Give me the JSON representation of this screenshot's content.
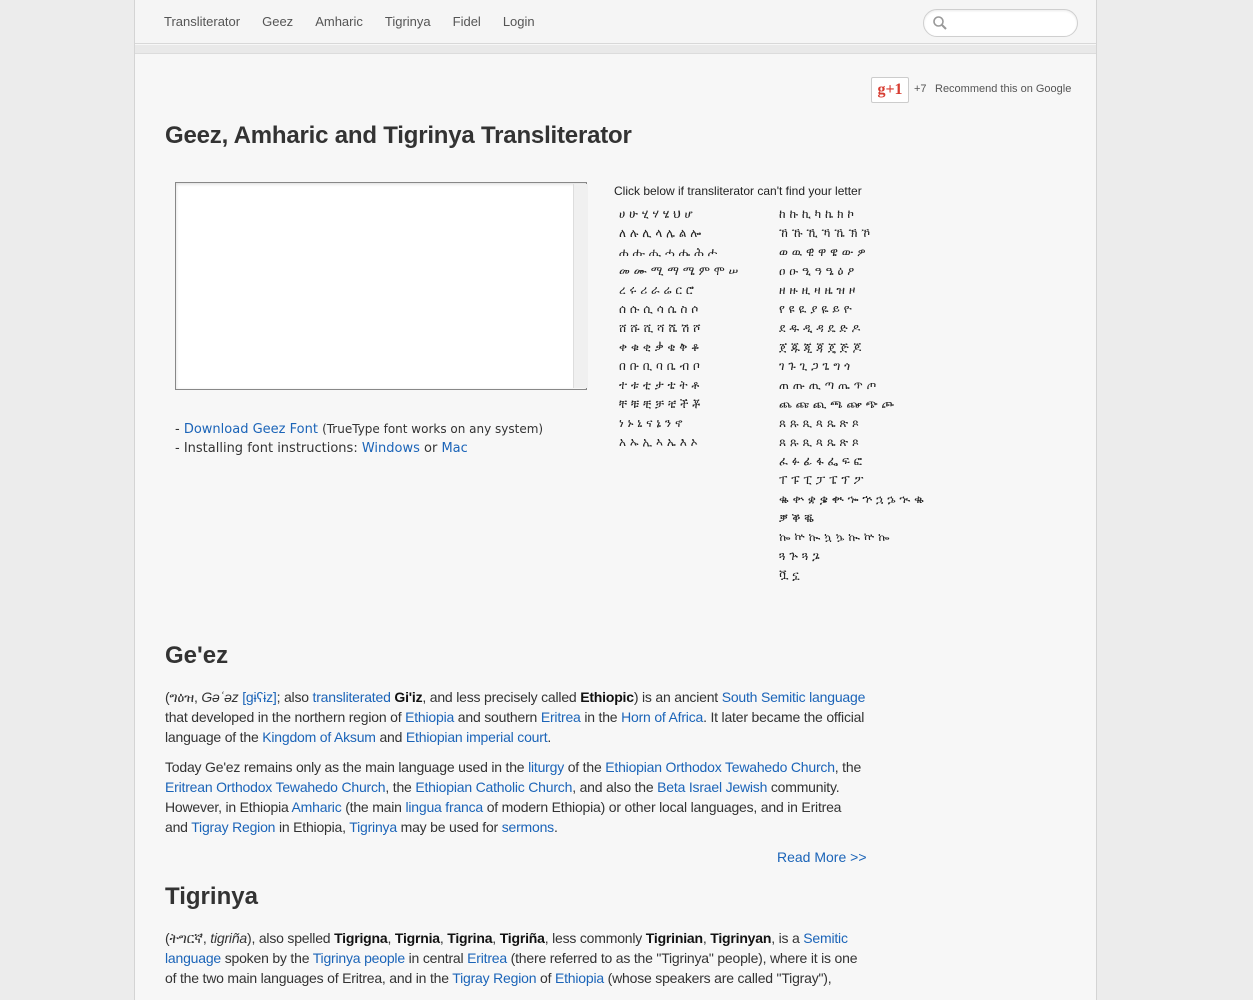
{
  "nav": {
    "items": [
      "Transliterator",
      "Geez",
      "Amharic",
      "Tigrinya",
      "Fidel",
      "Login"
    ],
    "search_placeholder": ""
  },
  "social": {
    "gplus_label": "g+1",
    "count": "+7",
    "recommend": "Recommend this on Google"
  },
  "page_title": "Geez, Amharic and Tigrinya Transliterator",
  "translit_value": "",
  "links": {
    "line1_prefix": "- ",
    "download_label": "Download Geez Font",
    "download_note": "(TrueType font works on any system)",
    "line2_prefix": "- Installing font instructions: ",
    "windows_label": "Windows",
    "or": "or",
    "mac_label": "Mac"
  },
  "fidel": {
    "helper": "Click below if transliterator can't find your letter",
    "left_rows": [
      "ሀ ሁ ሂ ሃ ሄ ህ ሆ",
      "ለ ሉ ሊ ላ ሌ ል ሎ",
      "ሐ ሑ ሒ ሓ ሔ ሕ ሖ",
      "መ ሙ ሚ ማ ሜ ም ሞ ሠ",
      "ረ ሩ ሪ ራ ሬ ር ሮ",
      "ሰ ሱ ሲ ሳ ሴ ስ ሶ",
      "ሸ ሹ ሺ ሻ ሼ ሽ ሾ",
      "ቀ ቁ ቂ ቃ ቄ ቅ ቆ",
      "በ ቡ ቢ ባ ቤ ብ ቦ",
      "ተ ቱ ቲ ታ ቴ ት ቶ",
      "ቸ ቹ ቺ ቻ ቼ ች ቾ",
      "ነ ኑ ኒ ና ኔ ን ኖ",
      "አ ኡ ኢ ኣ ኤ እ ኦ"
    ],
    "right_rows": [
      "ከ ኩ ኪ ካ ኬ ክ ኮ",
      "ኸ ኹ ኺ ኻ ኼ ኽ ኾ",
      "ወ ዉ ዊ ዋ ዌ ው ዎ",
      "ዐ ዑ ዒ ዓ ዔ ዕ ዖ",
      "ዘ ዙ ዚ ዛ ዜ ዝ ዞ",
      "የ ዩ ዪ ያ ዬ ይ ዮ",
      "ደ ዱ ዲ ዳ ዴ ድ ዶ",
      "ጀ ጁ ጂ ጃ ጄ ጅ ጆ",
      "ገ ጉ ጊ ጋ ጌ ግ ጎ",
      "ጠ ጡ ጢ ጣ ጤ ጥ ጦ",
      "ጨ ጩ ጪ ጫ ጬ ጭ ጮ",
      "ጸ ጹ ጺ ጻ ጼ ጽ ጾ",
      "ጸ ጹ ጺ ጻ ጼ ጽ ጾ",
      "ፈ ፉ ፊ ፋ ፌ ፍ ፎ",
      "ፐ ፑ ፒ ፓ ፔ ፕ ፖ",
      "ቈ ቍ ቋ ቌ ቊ ኈ ኍ ኋ ኌ ኊ ቈ",
      "ቓ ቕ ቘ",
      "ኰ ኵ ኲ ኳ ኴ ኲ ኵ ኰ",
      "ጓ ጕ ጓ ጔ",
      "ቯ ኗ"
    ]
  },
  "geez": {
    "heading": "Ge'ez",
    "p1": {
      "t1": "(",
      "script": "ግዕዝ",
      "t2": ", ",
      "translit": "Gəʿəz",
      "t3": " ",
      "ipa": "[ɡɨʕɨz]",
      "t4": "; also ",
      "transliterated": "transliterated",
      "t5": " ",
      "giiz": "Gi'iz",
      "t6": ", and less precisely called ",
      "ethiopic": "Ethiopic",
      "t7": ") is an ancient ",
      "south_semitic": "South Semitic language",
      "t8": " that developed in the northern region of ",
      "ethiopia": "Ethiopia",
      "t9": " and southern ",
      "eritrea": "Eritrea",
      "t10": " in the ",
      "horn": "Horn of Africa",
      "t11": ". It later became the official language of the ",
      "aksum": "Kingdom of Aksum",
      "t12": " and ",
      "court": "Ethiopian imperial court",
      "t13": "."
    },
    "p2": {
      "t1": "Today Ge'ez remains only as the main language used in the ",
      "liturgy": "liturgy",
      "t2": " of the ",
      "eotc": "Ethiopian Orthodox Tewahedo Church",
      "t3": ", the ",
      "erotc": "Eritrean Orthodox Tewahedo Church",
      "t4": ", the ",
      "catholic": "Ethiopian Catholic Church",
      "t5": ", and also the ",
      "beta": "Beta Israel Jewish",
      "t6": " community. However, in Ethiopia ",
      "amharic": "Amharic",
      "t7": " (the main ",
      "lingua": "lingua franca",
      "t8": " of modern Ethiopia) or other local languages, and in Eritrea and ",
      "tigray": "Tigray Region",
      "t9": " in Ethiopia, ",
      "tigrinya": "Tigrinya",
      "t10": " may be used for ",
      "sermons": "sermons",
      "t11": "."
    },
    "read_more": "Read More >>"
  },
  "tigrinya": {
    "heading": "Tigrinya",
    "p1": {
      "t1": "(",
      "script": "ትግርኛ",
      "t2": ", ",
      "translit": "tigriña",
      "t3": "), also spelled ",
      "b1": "Tigrigna",
      "c1": ", ",
      "b2": "Tigrnia",
      "c2": ", ",
      "b3": "Tigrina",
      "c3": ", ",
      "b4": "Tigriña",
      "t4": ", less commonly ",
      "b5": "Tigrinian",
      "c4": ", ",
      "b6": "Tigrinyan",
      "t5": ", is a ",
      "semitic": "Semitic language",
      "t6": " spoken by the ",
      "people": "Tigrinya people",
      "t7": " in central ",
      "eritrea": "Eritrea",
      "t8": " (there referred to as the \"Tigrinya\" people), where it is one of the two main languages of Eritrea, and in the ",
      "tigray": "Tigray Region",
      "t9": " of ",
      "ethiopia": "Ethiopia",
      "t10": " (whose speakers are called \"Tigray\"),"
    }
  }
}
